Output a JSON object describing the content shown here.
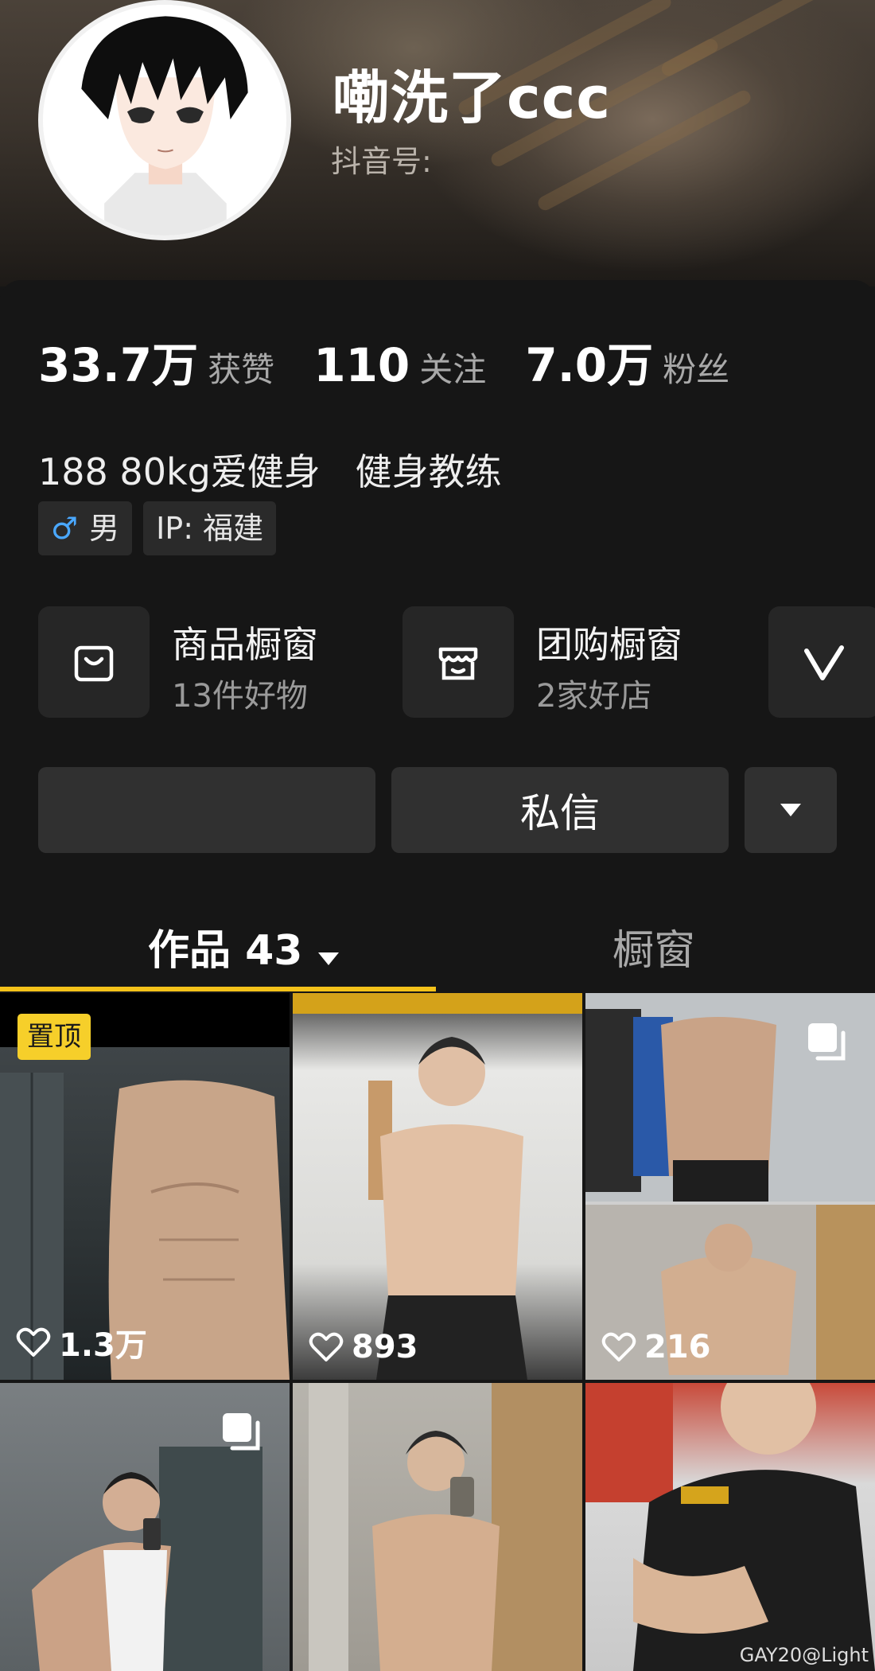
{
  "profile": {
    "nickname": "嘞洗了ccc",
    "douyin_id_label": "抖音号:",
    "stats": [
      {
        "value": "33.7万",
        "label": "获赞"
      },
      {
        "value": "110",
        "label": "关注"
      },
      {
        "value": "7.0万",
        "label": "粉丝"
      }
    ],
    "bio": "188 80kg爱健身   健身教练",
    "tags": {
      "gender_symbol": "♂",
      "gender": "男",
      "ip": "IP:  福建"
    }
  },
  "shop_cards": [
    {
      "title": "商品橱窗",
      "subtitle": "13件好物",
      "icon": "shopping-bag-icon"
    },
    {
      "title": "团购橱窗",
      "subtitle": "2家好店",
      "icon": "store-icon"
    },
    {
      "icon": "v-logo-icon"
    }
  ],
  "actions": {
    "follow_label": "",
    "message_label": "私信"
  },
  "tabs": {
    "works_label": "作品 43",
    "window_label": "橱窗"
  },
  "posts": [
    {
      "likes": "1.3万",
      "pinned_label": "置顶"
    },
    {
      "likes": "893"
    },
    {
      "likes": "216",
      "multi": true
    },
    {
      "multi": true
    },
    {},
    {}
  ],
  "watermark": "GAY20@Light",
  "colors": {
    "accent": "#f4c21a",
    "pin_bg": "#f6cf2a",
    "male_blue": "#4aa8ff",
    "background": "#161616"
  }
}
